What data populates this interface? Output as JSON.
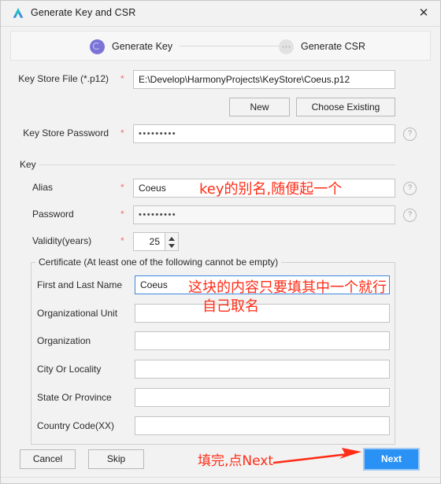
{
  "window": {
    "title": "Generate Key and CSR",
    "logo_icon": "deveco-logo-icon",
    "close_icon": "✕"
  },
  "stepper": {
    "steps": [
      {
        "label": "Generate Key",
        "state": "active"
      },
      {
        "label": "Generate CSR",
        "state": "inactive"
      }
    ],
    "active_color": "#7b74d6",
    "inactive_color": "#e2e2e2"
  },
  "form": {
    "key_store_file": {
      "label": "Key Store File (*.p12)",
      "required": "*",
      "value": "E:\\Develop\\HarmonyProjects\\KeyStore\\Coeus.p12",
      "placeholder": ""
    },
    "new_button": "New",
    "choose_existing_button": "Choose Existing",
    "key_store_password": {
      "label": "Key Store Password",
      "required": "*",
      "value": "•••••••••",
      "help": "?"
    }
  },
  "key_group": {
    "title": "Key",
    "alias": {
      "label": "Alias",
      "required": "*",
      "value": "Coeus",
      "help": "?"
    },
    "password": {
      "label": "Password",
      "required": "*",
      "value": "•••••••••",
      "help": "?"
    },
    "validity": {
      "label": "Validity(years)",
      "required": "*",
      "value": "25"
    }
  },
  "certificate_group": {
    "legend": "Certificate (At least one of the following cannot be empty)",
    "fields": [
      {
        "label": "First and Last Name",
        "value": "Coeus",
        "focused": true
      },
      {
        "label": "Organizational Unit",
        "value": "",
        "focused": false
      },
      {
        "label": "Organization",
        "value": "",
        "focused": false
      },
      {
        "label": "City Or Locality",
        "value": "",
        "focused": false
      },
      {
        "label": "State Or Province",
        "value": "",
        "focused": false
      },
      {
        "label": "Country Code(XX)",
        "value": "",
        "focused": false
      }
    ]
  },
  "footer": {
    "cancel": "Cancel",
    "skip": "Skip",
    "next": "Next",
    "next_color": "#2a92f5"
  },
  "annotations": {
    "color": "#ff2d17",
    "alias_note": "key的别名,随便起一个",
    "certificate_note_line1": "这块的内容只要填其中一个就行",
    "certificate_note_line2": "自己取名",
    "next_note": "填完,点Next"
  }
}
